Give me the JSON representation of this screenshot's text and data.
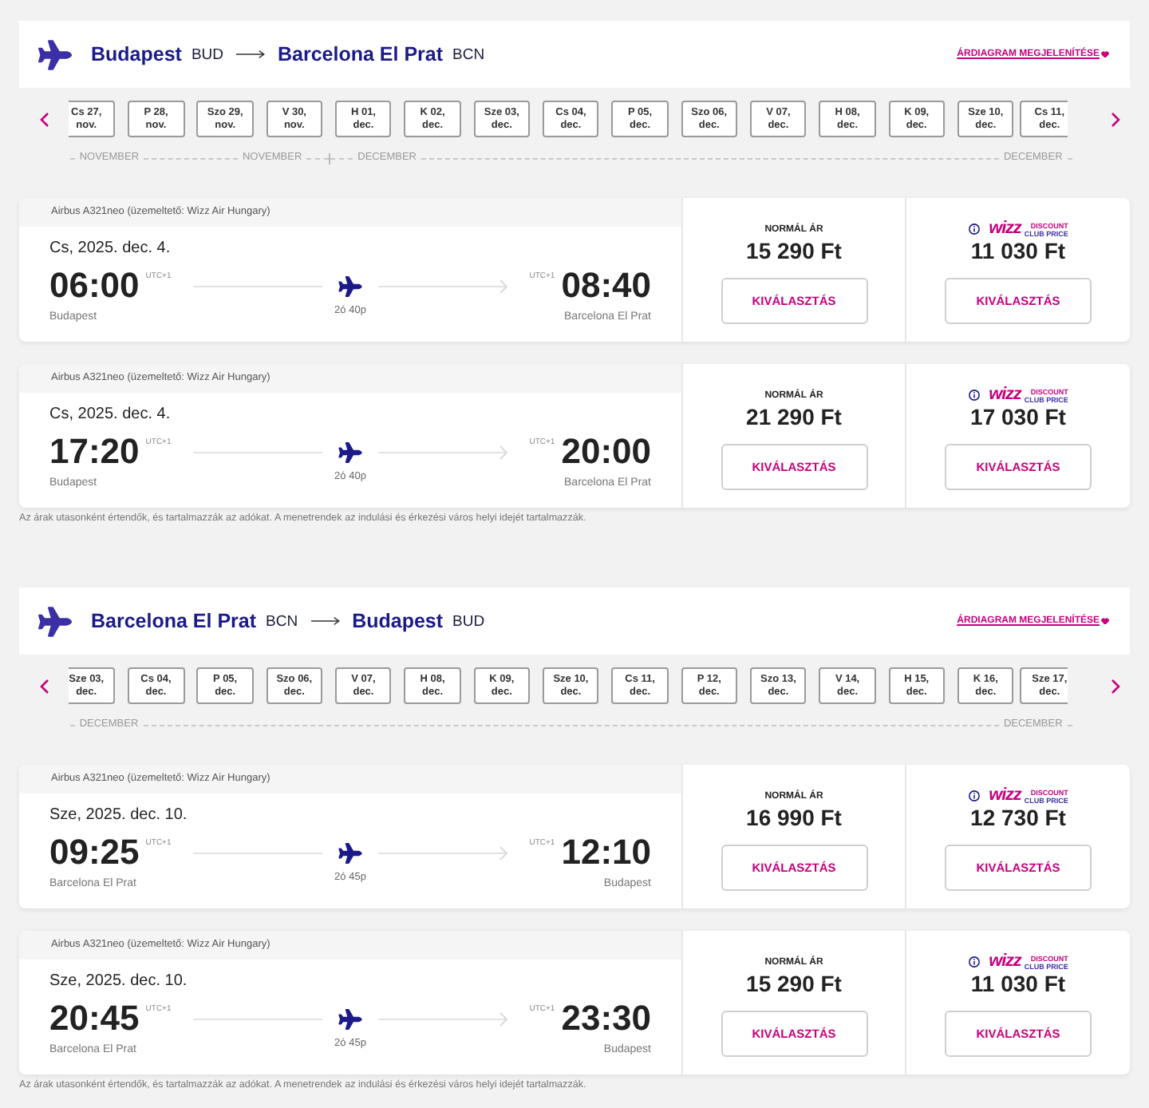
{
  "sections": [
    {
      "route": {
        "origin_city": "Budapest",
        "origin_code": "BUD",
        "destination_city": "Barcelona El Prat",
        "destination_code": "BCN"
      },
      "chart_link": "ÁRDIAGRAM MEGJELENÍTÉSE",
      "date_strip": {
        "months": [
          {
            "start_label": "NOVEMBER",
            "end_label": "NOVEMBER",
            "dates": [
              {
                "day": "Cs 27,",
                "month": "nov."
              },
              {
                "day": "P 28,",
                "month": "nov."
              },
              {
                "day": "Szo 29,",
                "month": "nov."
              },
              {
                "day": "V 30,",
                "month": "nov."
              }
            ]
          },
          {
            "start_label": "DECEMBER",
            "end_label": "DECEMBER",
            "dates": [
              {
                "day": "H 01,",
                "month": "dec."
              },
              {
                "day": "K 02,",
                "month": "dec."
              },
              {
                "day": "Sze 03,",
                "month": "dec."
              },
              {
                "day": "Cs 04,",
                "month": "dec."
              },
              {
                "day": "P 05,",
                "month": "dec."
              },
              {
                "day": "Szo 06,",
                "month": "dec."
              },
              {
                "day": "V 07,",
                "month": "dec."
              },
              {
                "day": "H 08,",
                "month": "dec."
              },
              {
                "day": "K 09,",
                "month": "dec."
              },
              {
                "day": "Sze 10,",
                "month": "dec."
              },
              {
                "day": "Cs 11,",
                "month": "dec."
              }
            ]
          }
        ]
      },
      "flights": [
        {
          "aircraft": "Airbus A321neo (üzemeltető: Wizz Air Hungary)",
          "date": "Cs, 2025. dec. 4.",
          "departure_time": "06:00",
          "departure_tz": "UTC+1",
          "arrival_tz": "UTC+1",
          "arrival_time": "08:40",
          "duration": "2ó 40p",
          "origin": "Budapest",
          "destination": "Barcelona El Prat",
          "fares": [
            {
              "kind": "normal",
              "label": "NORMÁL ÁR",
              "price": "15 290 Ft",
              "button": "KIVÁLASZTÁS"
            },
            {
              "kind": "club",
              "logo": {
                "brand": "wizz",
                "line1": "DISCOUNT",
                "line2": "CLUB PRICE"
              },
              "price": "11 030 Ft",
              "button": "KIVÁLASZTÁS"
            }
          ]
        },
        {
          "aircraft": "Airbus A321neo (üzemeltető: Wizz Air Hungary)",
          "date": "Cs, 2025. dec. 4.",
          "departure_time": "17:20",
          "departure_tz": "UTC+1",
          "arrival_tz": "UTC+1",
          "arrival_time": "20:00",
          "duration": "2ó 40p",
          "origin": "Budapest",
          "destination": "Barcelona El Prat",
          "fares": [
            {
              "kind": "normal",
              "label": "NORMÁL ÁR",
              "price": "21 290 Ft",
              "button": "KIVÁLASZTÁS"
            },
            {
              "kind": "club",
              "logo": {
                "brand": "wizz",
                "line1": "DISCOUNT",
                "line2": "CLUB PRICE"
              },
              "price": "17 030 Ft",
              "button": "KIVÁLASZTÁS"
            }
          ]
        }
      ],
      "note": "Az árak utasonként értendők, és tartalmazzák az adókat. A menetrendek az indulási és érkezési város helyi idejét tartalmazzák."
    },
    {
      "route": {
        "origin_city": "Barcelona El Prat",
        "origin_code": "BCN",
        "destination_city": "Budapest",
        "destination_code": "BUD"
      },
      "chart_link": "ÁRDIAGRAM MEGJELENÍTÉSE",
      "date_strip": {
        "months": [
          {
            "start_label": "DECEMBER",
            "end_label": "DECEMBER",
            "dates": [
              {
                "day": "Sze 03,",
                "month": "dec."
              },
              {
                "day": "Cs 04,",
                "month": "dec."
              },
              {
                "day": "P 05,",
                "month": "dec."
              },
              {
                "day": "Szo 06,",
                "month": "dec."
              },
              {
                "day": "V 07,",
                "month": "dec."
              },
              {
                "day": "H 08,",
                "month": "dec."
              },
              {
                "day": "K 09,",
                "month": "dec."
              },
              {
                "day": "Sze 10,",
                "month": "dec."
              },
              {
                "day": "Cs 11,",
                "month": "dec."
              },
              {
                "day": "P 12,",
                "month": "dec."
              },
              {
                "day": "Szo 13,",
                "month": "dec."
              },
              {
                "day": "V 14,",
                "month": "dec."
              },
              {
                "day": "H 15,",
                "month": "dec."
              },
              {
                "day": "K 16,",
                "month": "dec."
              },
              {
                "day": "Sze 17,",
                "month": "dec."
              }
            ]
          }
        ]
      },
      "flights": [
        {
          "aircraft": "Airbus A321neo (üzemeltető: Wizz Air Hungary)",
          "date": "Sze, 2025. dec. 10.",
          "departure_time": "09:25",
          "departure_tz": "UTC+1",
          "arrival_tz": "UTC+1",
          "arrival_time": "12:10",
          "duration": "2ó 45p",
          "origin": "Barcelona El Prat",
          "destination": "Budapest",
          "fares": [
            {
              "kind": "normal",
              "label": "NORMÁL ÁR",
              "price": "16 990 Ft",
              "button": "KIVÁLASZTÁS"
            },
            {
              "kind": "club",
              "logo": {
                "brand": "wizz",
                "line1": "DISCOUNT",
                "line2": "CLUB PRICE"
              },
              "price": "12 730 Ft",
              "button": "KIVÁLASZTÁS"
            }
          ]
        },
        {
          "aircraft": "Airbus A321neo (üzemeltető: Wizz Air Hungary)",
          "date": "Sze, 2025. dec. 10.",
          "departure_time": "20:45",
          "departure_tz": "UTC+1",
          "arrival_tz": "UTC+1",
          "arrival_time": "23:30",
          "duration": "2ó 45p",
          "origin": "Barcelona El Prat",
          "destination": "Budapest",
          "fares": [
            {
              "kind": "normal",
              "label": "NORMÁL ÁR",
              "price": "15 290 Ft",
              "button": "KIVÁLASZTÁS"
            },
            {
              "kind": "club",
              "logo": {
                "brand": "wizz",
                "line1": "DISCOUNT",
                "line2": "CLUB PRICE"
              },
              "price": "11 030 Ft",
              "button": "KIVÁLASZTÁS"
            }
          ]
        }
      ],
      "note": "Az árak utasonként értendők, és tartalmazzák az adókat. A menetrendek az indulási és érkezési város helyi idejét tartalmazzák."
    }
  ]
}
